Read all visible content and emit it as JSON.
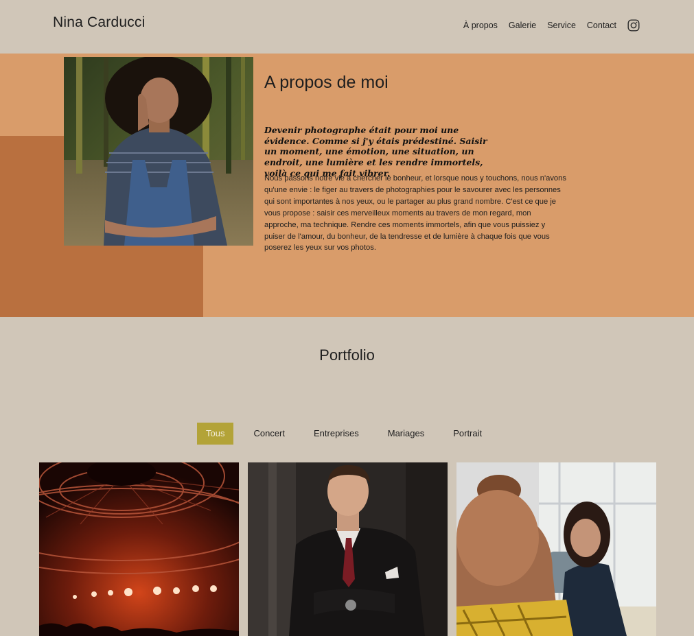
{
  "header": {
    "brand": "Nina Carducci",
    "nav": [
      "À propos",
      "Galerie",
      "Service",
      "Contact"
    ],
    "social_icon": "instagram-icon"
  },
  "about": {
    "title": "A propos de moi",
    "quote": "Devenir photographe était pour moi une évidence. Comme si j'y étais prédestiné. Saisir un moment, une émotion, une situation, un endroit, une lumière et les rendre immortels, voilà ce qui me fait vibrer.",
    "text": "Nous passons notre vie à chercher le bonheur, et lorsque nous y touchons, nous n'avons qu'une envie : le figer au travers de photographies pour le savourer avec les personnes qui sont importantes à nos yeux, ou le partager au plus grand nombre. C'est ce que je vous propose : saisir ces merveilleux moments au travers de mon regard, mon approche, ma technique. Rendre ces moments immortels, afin que vous puissiez y puiser de l'amour, du bonheur, de la tendresse et de lumière à chaque fois que vous poserez les yeux sur vos photos."
  },
  "portfolio": {
    "title": "Portfolio",
    "filters": [
      "Tous",
      "Concert",
      "Entreprises",
      "Mariages",
      "Portrait"
    ],
    "active_filter": "Tous"
  },
  "colors": {
    "background": "#d0c6b8",
    "about_bg": "#d99c6a",
    "about_accent": "#b9703f",
    "filter_active": "#b3a338"
  }
}
